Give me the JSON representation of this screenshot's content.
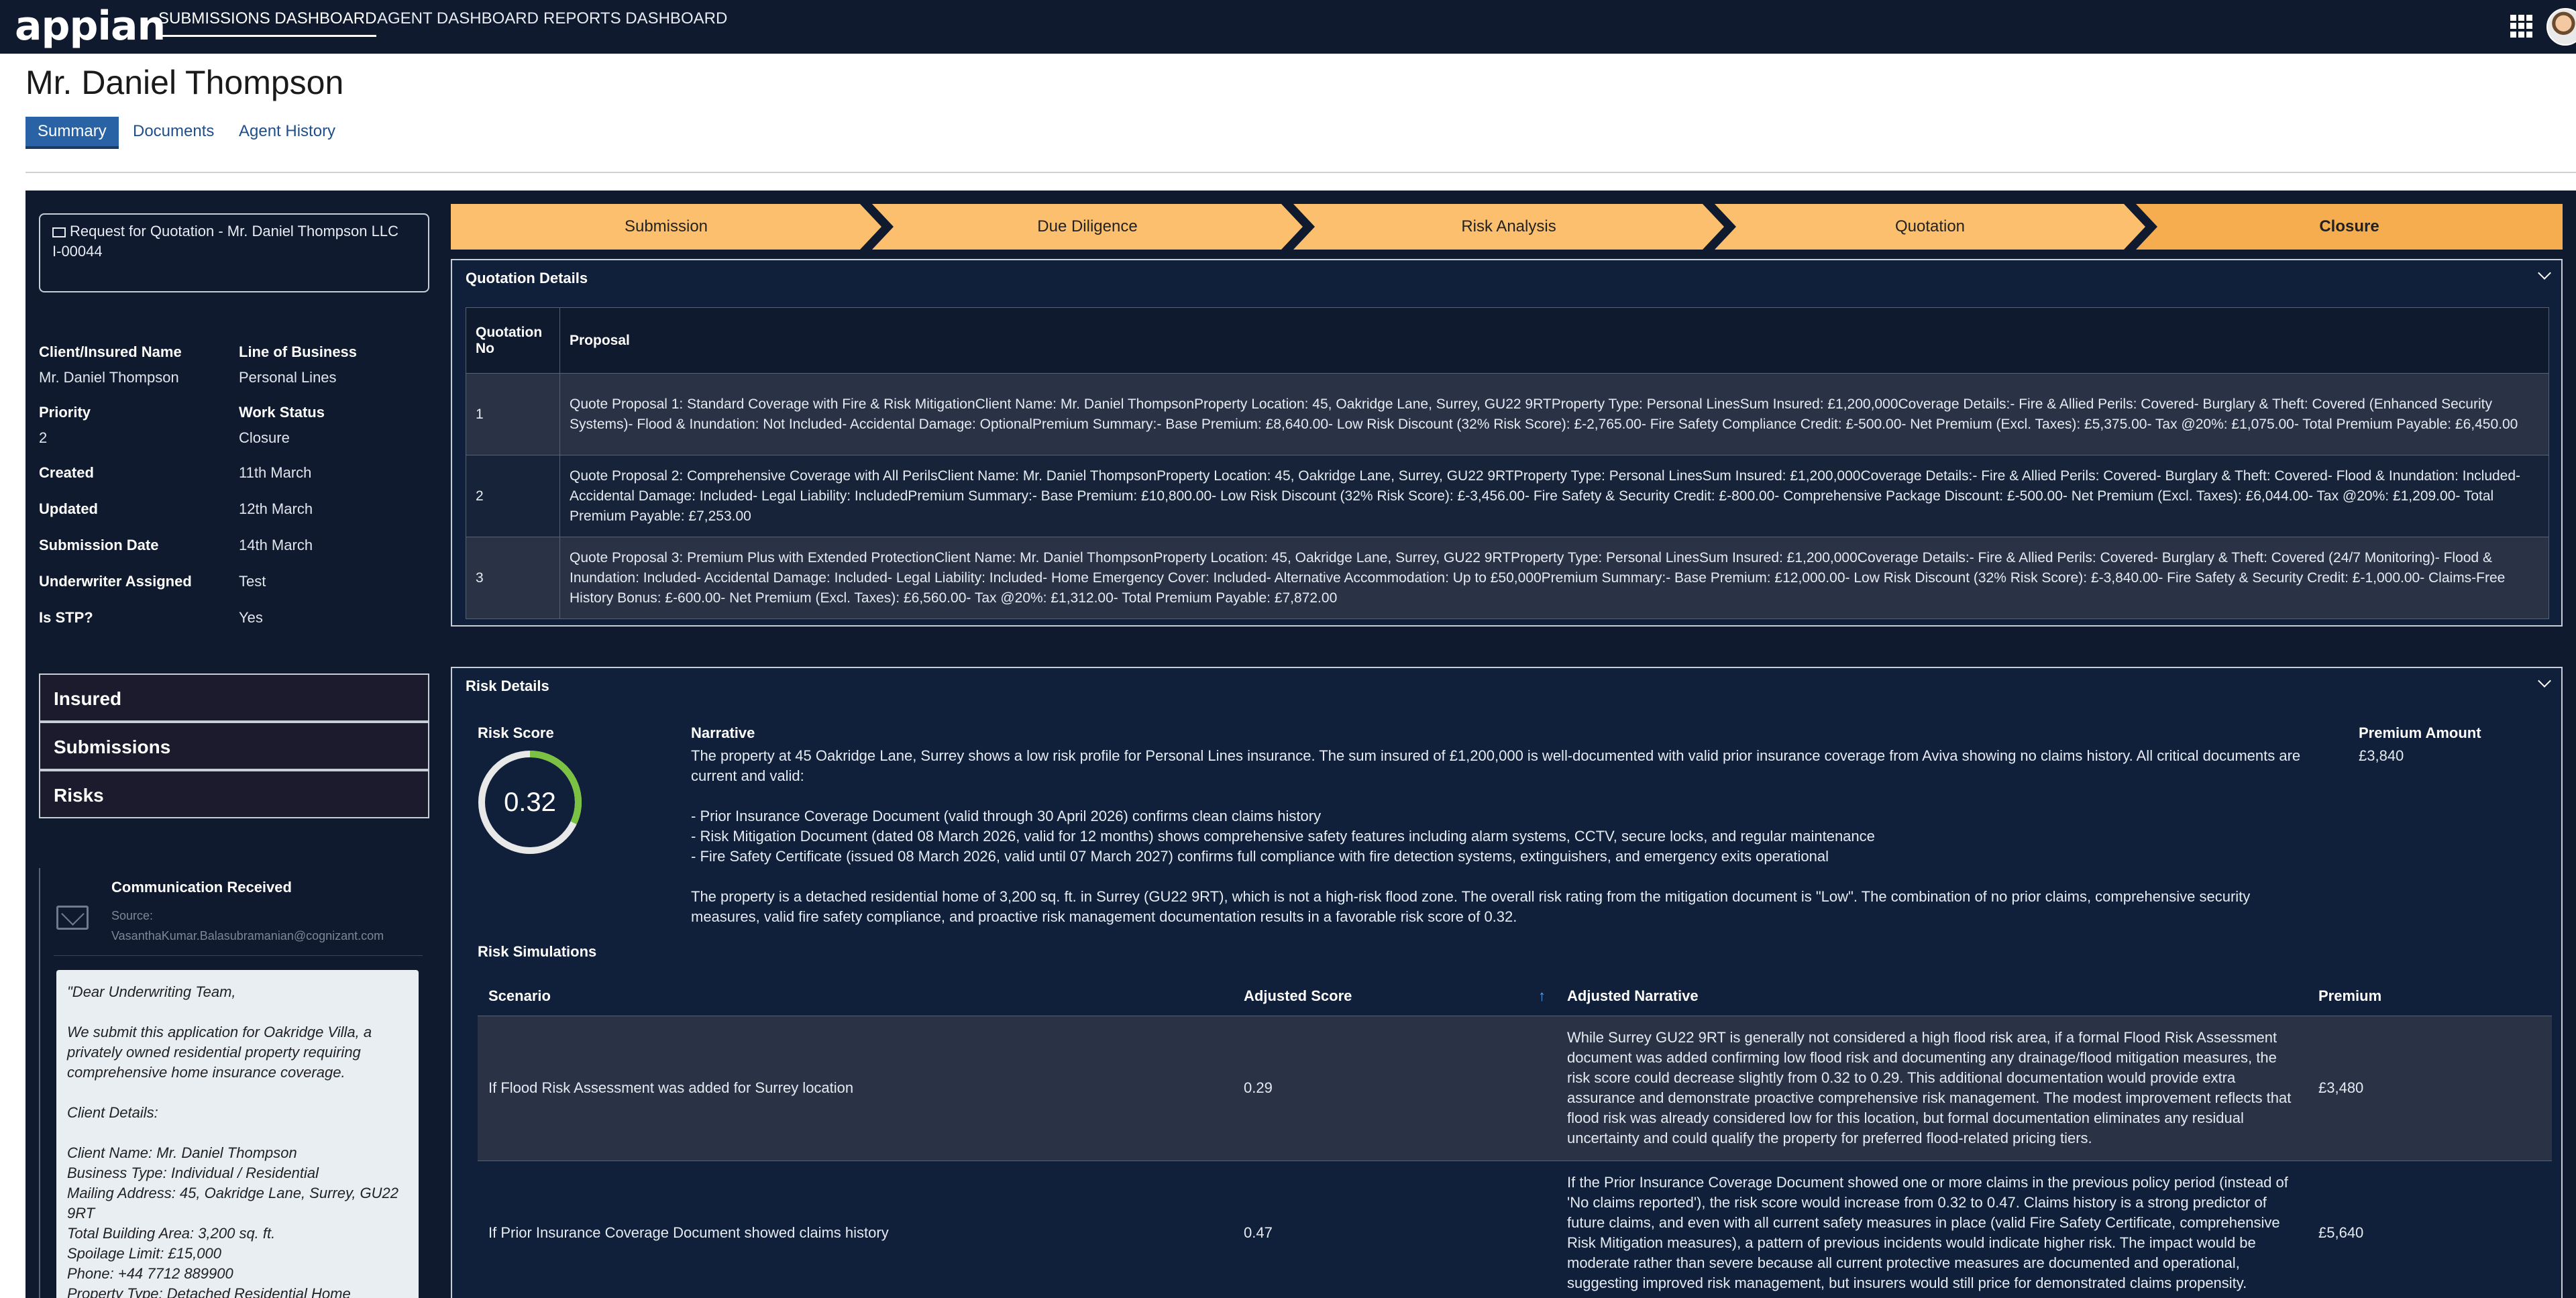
{
  "app": {
    "logo": "appian",
    "nav_tabs": [
      "SUBMISSIONS DASHBOARD",
      "AGENT DASHBOARD",
      "REPORTS DASHBOARD"
    ]
  },
  "page": {
    "title": "Mr. Daniel Thompson",
    "tabs": [
      "Summary",
      "Documents",
      "Agent History"
    ]
  },
  "sidebar": {
    "request_title": "Request for Quotation - Mr. Daniel Thompson LLC",
    "request_id": "I-00044",
    "fields": {
      "client_label": "Client/Insured Name",
      "client_value": "Mr. Daniel Thompson",
      "lob_label": "Line of Business",
      "lob_value": "Personal Lines",
      "priority_label": "Priority",
      "priority_value": "2",
      "work_status_label": "Work Status",
      "work_status_value": "Closure",
      "created_label": "Created",
      "created_value": "11th March",
      "updated_label": "Updated",
      "updated_value": "12th March",
      "submission_date_label": "Submission Date",
      "submission_date_value": "14th March",
      "underwriter_label": "Underwriter Assigned",
      "underwriter_value": "Test",
      "stp_label": "Is STP?",
      "stp_value": "Yes"
    },
    "sections": [
      "Insured",
      "Submissions",
      "Risks"
    ],
    "communication": {
      "title": "Communication Received",
      "source_label": "Source:",
      "source_value": "VasanthaKumar.Balasubramanian@cognizant.com",
      "body": {
        "greeting": "\"Dear Underwriting Team,",
        "intro": "We submit this application for Oakridge Villa, a privately owned residential property requiring comprehensive home insurance coverage.",
        "details_heading": "Client Details:",
        "client_name": "Client Name: Mr. Daniel Thompson",
        "business_type": "Business Type: Individual / Residential",
        "mailing_address": "Mailing Address: 45, Oakridge Lane, Surrey, GU22 9RT",
        "building_area": "Total Building Area: 3,200 sq. ft.",
        "spoilage_limit": "Spoilage Limit: £15,000",
        "phone": "Phone: +44 7712 889900",
        "property_type": "Property Type: Detached Residential Home"
      }
    }
  },
  "stepper": [
    "Submission",
    "Due Diligence",
    "Risk Analysis",
    "Quotation",
    "Closure"
  ],
  "quotation": {
    "title": "Quotation Details",
    "headers": [
      "Quotation No",
      "Proposal"
    ],
    "rows": [
      {
        "no": "1",
        "proposal": "Quote Proposal 1: Standard Coverage with Fire & Risk MitigationClient Name: Mr. Daniel ThompsonProperty Location: 45, Oakridge Lane, Surrey, GU22 9RTProperty Type: Personal LinesSum Insured: £1,200,000Coverage Details:- Fire & Allied Perils: Covered- Burglary & Theft: Covered (Enhanced Security Systems)- Flood & Inundation: Not Included- Accidental Damage: OptionalPremium Summary:- Base Premium: £8,640.00- Low Risk Discount (32% Risk Score): £-2,765.00- Fire Safety Compliance Credit: £-500.00- Net Premium (Excl. Taxes): £5,375.00- Tax @20%: £1,075.00- Total Premium Payable: £6,450.00"
      },
      {
        "no": "2",
        "proposal": "Quote Proposal 2: Comprehensive Coverage with All PerilsClient Name: Mr. Daniel ThompsonProperty Location: 45, Oakridge Lane, Surrey, GU22 9RTProperty Type: Personal LinesSum Insured: £1,200,000Coverage Details:- Fire & Allied Perils: Covered- Burglary & Theft: Covered- Flood & Inundation: Included- Accidental Damage: Included- Legal Liability: IncludedPremium Summary:- Base Premium: £10,800.00- Low Risk Discount (32% Risk Score): £-3,456.00- Fire Safety & Security Credit: £-800.00- Comprehensive Package Discount: £-500.00- Net Premium (Excl. Taxes): £6,044.00- Tax @20%: £1,209.00- Total Premium Payable: £7,253.00"
      },
      {
        "no": "3",
        "proposal": "Quote Proposal 3: Premium Plus with Extended ProtectionClient Name: Mr. Daniel ThompsonProperty Location: 45, Oakridge Lane, Surrey, GU22 9RTProperty Type: Personal LinesSum Insured: £1,200,000Coverage Details:- Fire & Allied Perils: Covered- Burglary & Theft: Covered (24/7 Monitoring)- Flood & Inundation: Included- Accidental Damage: Included- Legal Liability: Included- Home Emergency Cover: Included- Alternative Accommodation: Up to £50,000Premium Summary:- Base Premium: £12,000.00- Low Risk Discount (32% Risk Score): £-3,840.00- Fire Safety & Security Credit: £-1,000.00- Claims-Free History Bonus: £-600.00- Net Premium (Excl. Taxes): £6,560.00- Tax @20%: £1,312.00- Total Premium Payable: £7,872.00"
      }
    ]
  },
  "risk": {
    "title": "Risk Details",
    "score_label": "Risk Score",
    "score": "0.32",
    "score_fraction": 0.32,
    "narrative_label": "Narrative",
    "narrative_p1": "The property at 45 Oakridge Lane, Surrey shows a low risk profile for Personal Lines insurance. The sum insured of £1,200,000 is well-documented with valid prior insurance coverage from Aviva showing no claims history. All critical documents are current and valid:",
    "narrative_b1": "- Prior Insurance Coverage Document (valid through 30 April 2026) confirms clean claims history",
    "narrative_b2": "- Risk Mitigation Document (dated 08 March 2026, valid for 12 months) shows comprehensive safety features including alarm systems, CCTV, secure locks, and regular maintenance",
    "narrative_b3": "- Fire Safety Certificate (issued 08 March 2026, valid until 07 March 2027) confirms full compliance with fire detection systems, extinguishers, and emergency exits operational",
    "narrative_p2": "The property is a detached residential home of 3,200 sq. ft. in Surrey (GU22 9RT), which is not a high-risk flood zone. The overall risk rating from the mitigation document is \"Low\". The combination of no prior claims, comprehensive security measures, valid fire safety compliance, and proactive risk management documentation results in a favorable risk score of 0.32.",
    "premium_label": "Premium Amount",
    "premium_value": "£3,840",
    "simulations_label": "Risk Simulations",
    "sim_headers": [
      "Scenario",
      "Adjusted Score",
      "Adjusted Narrative",
      "Premium"
    ],
    "simulations": [
      {
        "scenario": "If Flood Risk Assessment was added for Surrey location",
        "score": "0.29",
        "narrative": "While Surrey GU22 9RT is generally not considered a high flood risk area, if a formal Flood Risk Assessment document was added confirming low flood risk and documenting any drainage/flood mitigation measures, the risk score could decrease slightly from 0.32 to 0.29. This additional documentation would provide extra assurance and demonstrate proactive comprehensive risk management. The modest improvement reflects that flood risk was already considered low for this location, but formal documentation eliminates any residual uncertainty and could qualify the property for preferred flood-related pricing tiers.",
        "premium": "£3,480"
      },
      {
        "scenario": "If Prior Insurance Coverage Document showed claims history",
        "score": "0.47",
        "narrative": "If the Prior Insurance Coverage Document showed one or more claims in the previous policy period (instead of 'No claims reported'), the risk score would increase from 0.32 to 0.47. Claims history is a strong predictor of future claims, and even with all current safety measures in place (valid Fire Safety Certificate, comprehensive Risk Mitigation measures), a pattern of previous incidents would indicate higher risk. The impact would be moderate rather than severe because all current protective measures are documented and operational, suggesting improved risk management, but insurers would still price for demonstrated claims propensity.",
        "premium": "£5,640"
      }
    ]
  }
}
